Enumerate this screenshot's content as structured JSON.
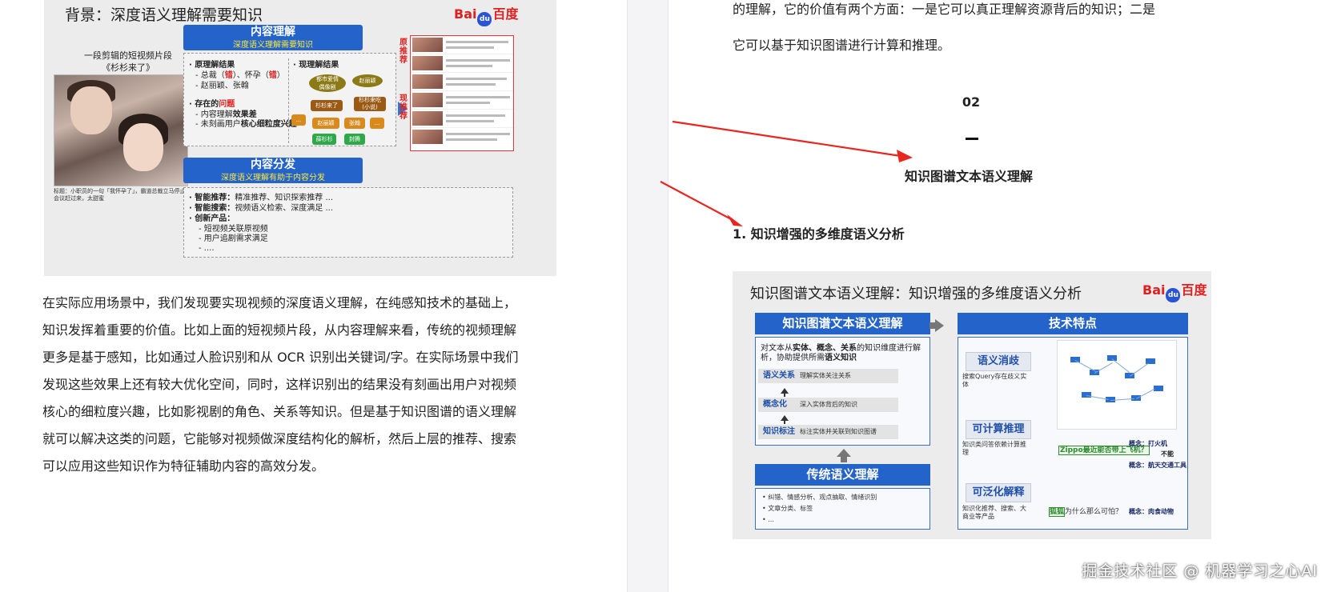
{
  "left_slide": {
    "title": "背景：深度语义理解需要知识",
    "logo_text": [
      "Bai",
      "百度"
    ],
    "clip_caption": "一段剪辑的短视频片段\n《杉杉来了》",
    "clip_footer": "标题：小职员的一句「我怀孕了」，霸道总裁立马停止会议赶过来，太甜蜜",
    "understanding": {
      "head": "内容理解",
      "sub": "深度语义理解需要知识",
      "orig_title": "· 原理解结果",
      "orig_items": [
        "- 总裁（",
        "错",
        "）、怀孕（",
        "错",
        "）",
        "- 赵丽颖、张翰"
      ],
      "problem_title_pre": "· 存在的",
      "problem_title_hl": "问题",
      "problem_items": [
        "- 内容理解",
        "效果差",
        "- 未刻画用户",
        "核心细粒度兴趣"
      ],
      "now_title": "· 现理解结果",
      "nodes": [
        "都市爱情\n偶像剧",
        "赵丽颖",
        "杉杉来了",
        "杉杉来吃\n(小说)",
        "...",
        "赵丽颖",
        "张翰",
        "...",
        "薛杉杉",
        "封腾"
      ]
    },
    "distribution": {
      "head": "内容分发",
      "sub": "深度语义理解有助于内容分发",
      "items": [
        {
          "k": "· 智能推荐：",
          "v": "精准推荐、知识探索推荐 ..."
        },
        {
          "k": "· 智能搜索：",
          "v": "视频语义检索、深度满足 ..."
        },
        {
          "k": "· 创新产品：",
          "v": ""
        }
      ],
      "sub_items": [
        "- 短视频关联原视频",
        "- 用户追剧需求满足",
        "- ...."
      ]
    },
    "side_tags": [
      "原推荐",
      "现推荐"
    ]
  },
  "left_paragraph": "在实际应用场景中，我们发现要实现视频的深度语义理解，在纯感知技术的基础上，知识发挥着重要的价值。比如上面的短视频片段，从内容理解来看，传统的视频理解更多是基于感知，比如通过人脸识别和从 OCR 识别出关键词/字。在实际场景中我们发现这些效果上还有较大优化空间，同时，这样识别出的结果没有刻画出用户对视频核心的细粒度兴趣，比如影视剧的角色、关系等知识。但是基于知识图谱的语义理解就可以解决这类的问题，它能够对视频做深度结构化的解析，然后上层的推荐、搜索可以应用这些知识作为特征辅助内容的高效分发。",
  "right_top_text_1": "的理解，它的价值有两个方面：一是它可以真正理解资源背后的知识；二是",
  "right_top_text_2": "它可以基于知识图谱进行计算和推理。",
  "section_number": "02",
  "section_title": "知识图谱文本语义理解",
  "heading_1": "1. 知识增强的多维度语义分析",
  "right_slide": {
    "title": "知识图谱文本语义理解：知识增强的多维度语义分析",
    "logo_text": [
      "Bai",
      "百度"
    ],
    "left_head": "知识图谱文本语义理解",
    "intro_1": "对文本从",
    "intro_hl": "实体、概念、关系",
    "intro_2": "的知识维度进行解析，协助提供所需",
    "intro_hl2": "语义知识",
    "rows": [
      {
        "k": "语义关系",
        "v": "理解实体关注关系"
      },
      {
        "k": "概念化",
        "v": "深入实体背后的知识"
      },
      {
        "k": "知识标注",
        "v": "标注实体并关联到知识图谱"
      }
    ],
    "trad_head": "传统语义理解",
    "trad_items": [
      "• 纠错、情感分析、观点抽取、情绪识别",
      "• 文章分类、标签",
      "• ..."
    ],
    "tech_head": "技术特点",
    "features": [
      {
        "label": "语义消歧",
        "desc": "搜索Query存在歧义实体"
      },
      {
        "label": "可计算推理",
        "desc": "知识类问答依赖计算推理"
      },
      {
        "label": "可泛化解释",
        "desc": "知识化推荐、搜索、大商业等产品"
      }
    ],
    "example_1": "Zippo最近能否带上飞机？",
    "concept_1": "概念：打火机",
    "not_allowed": "不能",
    "concept_2": "概念：航天交通工具",
    "example_2_hl": "狐狐",
    "example_2": "为什么那么可怕？",
    "concept_3": "概念：肉食动物"
  },
  "watermark": "掘金技术社区 @ 机器学习之心AI"
}
